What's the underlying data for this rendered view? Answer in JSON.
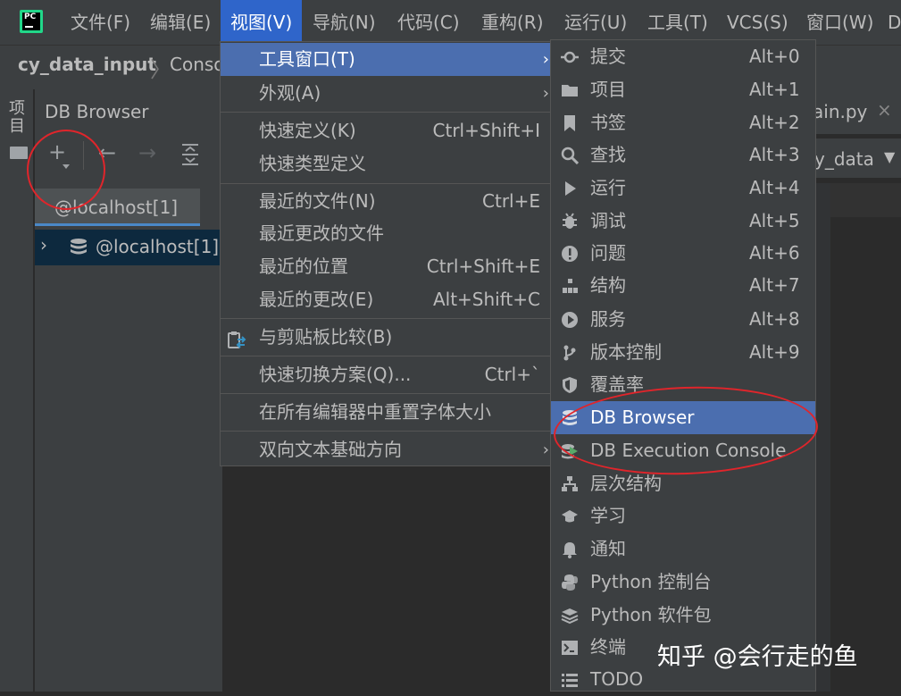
{
  "menubar": {
    "items": [
      {
        "label": "文件(F)",
        "key": "F"
      },
      {
        "label": "编辑(E)",
        "key": "E"
      },
      {
        "label": "视图(V)",
        "key": "V"
      },
      {
        "label": "导航(N)",
        "key": "N"
      },
      {
        "label": "代码(C)",
        "key": "C"
      },
      {
        "label": "重构(R)",
        "key": "R"
      },
      {
        "label": "运行(U)",
        "key": "U"
      },
      {
        "label": "工具(T)",
        "key": "T"
      },
      {
        "label": "VCS(S)",
        "key": "S"
      },
      {
        "label": "窗口(W)",
        "key": "W"
      }
    ]
  },
  "navbar": {
    "project": "cy_data_input",
    "console": "Conso"
  },
  "left_strip": {
    "label": "项目"
  },
  "db_browser": {
    "title": "DB Browser",
    "connection_tab": "@localhost[1]",
    "tree_item": "@localhost[1]"
  },
  "editor": {
    "tab": "ain.py",
    "combo": "y_data"
  },
  "view_menu": {
    "items": [
      {
        "label": "工具窗口(T)",
        "shortcut": "",
        "submenu": true
      },
      {
        "label": "外观(A)",
        "shortcut": "",
        "submenu": true
      },
      {
        "label": "快速定义(K)",
        "shortcut": "Ctrl+Shift+I"
      },
      {
        "label": "快速类型定义",
        "shortcut": ""
      },
      {
        "label": "最近的文件(N)",
        "shortcut": "Ctrl+E"
      },
      {
        "label": "最近更改的文件",
        "shortcut": ""
      },
      {
        "label": "最近的位置",
        "shortcut": "Ctrl+Shift+E"
      },
      {
        "label": "最近的更改(E)",
        "shortcut": "Alt+Shift+C"
      },
      {
        "label": "与剪贴板比较(B)",
        "shortcut": ""
      },
      {
        "label": "快速切换方案(Q)...",
        "shortcut": "Ctrl+`"
      },
      {
        "label": "在所有编辑器中重置字体大小",
        "shortcut": ""
      },
      {
        "label": "双向文本基础方向",
        "shortcut": "",
        "submenu": true
      }
    ]
  },
  "tool_windows": {
    "items": [
      {
        "icon": "commit-icon",
        "label": "提交",
        "shortcut": "Alt+0"
      },
      {
        "icon": "folder-icon",
        "label": "项目",
        "shortcut": "Alt+1"
      },
      {
        "icon": "bookmark-icon",
        "label": "书签",
        "shortcut": "Alt+2"
      },
      {
        "icon": "search-icon",
        "label": "查找",
        "shortcut": "Alt+3"
      },
      {
        "icon": "run-icon",
        "label": "运行",
        "shortcut": "Alt+4"
      },
      {
        "icon": "bug-icon",
        "label": "调试",
        "shortcut": "Alt+5"
      },
      {
        "icon": "problems-icon",
        "label": "问题",
        "shortcut": "Alt+6"
      },
      {
        "icon": "structure-icon",
        "label": "结构",
        "shortcut": "Alt+7"
      },
      {
        "icon": "services-icon",
        "label": "服务",
        "shortcut": "Alt+8"
      },
      {
        "icon": "vcs-branch-icon",
        "label": "版本控制",
        "shortcut": "Alt+9"
      },
      {
        "icon": "shield-icon",
        "label": "覆盖率",
        "shortcut": ""
      },
      {
        "icon": "database-icon",
        "label": "DB Browser",
        "shortcut": ""
      },
      {
        "icon": "db-console-icon",
        "label": "DB Execution Console",
        "shortcut": ""
      },
      {
        "icon": "hierarchy-icon",
        "label": "层次结构",
        "shortcut": ""
      },
      {
        "icon": "graduation-cap-icon",
        "label": "学习",
        "shortcut": ""
      },
      {
        "icon": "bell-icon",
        "label": "通知",
        "shortcut": ""
      },
      {
        "icon": "python-icon",
        "label": "Python 控制台",
        "shortcut": ""
      },
      {
        "icon": "layers-icon",
        "label": "Python 软件包",
        "shortcut": ""
      },
      {
        "icon": "terminal-icon",
        "label": "终端",
        "shortcut": ""
      },
      {
        "icon": "list-icon",
        "label": "TODO",
        "shortcut": ""
      }
    ]
  },
  "watermark": "知乎 @会行走的鱼",
  "colors": {
    "accent": "#2f65ca",
    "highlight": "#4b6eaf",
    "annotation": "#e0252b"
  }
}
